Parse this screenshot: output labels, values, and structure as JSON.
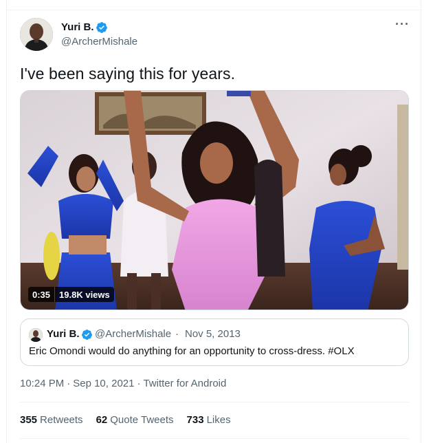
{
  "author": {
    "display_name": "Yuri B.",
    "handle": "@ArcherMishale",
    "verified_icon": "verified-badge-icon",
    "avatar_icon": "profile-avatar"
  },
  "tweet": {
    "text": "I've been saying this for years.",
    "more_icon": "more-options-icon"
  },
  "media": {
    "duration": "0:35",
    "views": "19.8K views"
  },
  "quoted": {
    "display_name": "Yuri B.",
    "handle": "@ArcherMishale",
    "dot": "·",
    "date": "Nov 5, 2013",
    "text": "Eric Omondi would do anything for an opportunity to cross-dress. #OLX"
  },
  "meta": {
    "time": "10:24 PM",
    "dot1": "·",
    "date": "Sep 10, 2021",
    "dot2": "·",
    "source": "Twitter for Android"
  },
  "stats": {
    "retweets_count": "355",
    "retweets_label": "Retweets",
    "quotes_count": "62",
    "quotes_label": "Quote Tweets",
    "likes_count": "733",
    "likes_label": "Likes"
  },
  "colors": {
    "text_primary": "#0f1419",
    "text_secondary": "#536471",
    "verified_blue": "#1d9bf0",
    "border": "#cfd9de"
  }
}
